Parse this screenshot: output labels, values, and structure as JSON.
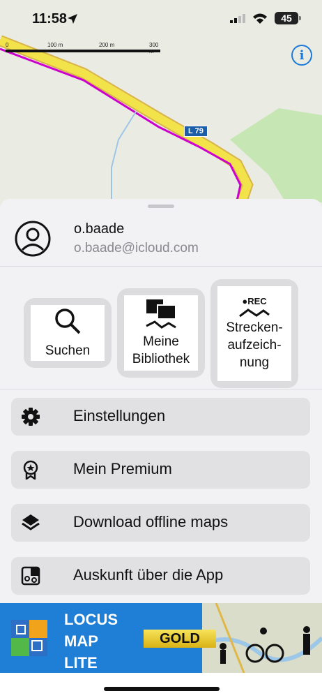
{
  "status_bar": {
    "time": "11:58",
    "battery": "45"
  },
  "map": {
    "scale_labels": [
      "0",
      "100 m",
      "200 m",
      "300 m"
    ],
    "road_label": "L 79",
    "info_icon": "info-icon"
  },
  "profile": {
    "name": "o.baade",
    "email": "o.baade@icloud.com",
    "avatar_icon": "user-circle-icon"
  },
  "tiles": [
    {
      "label_lines": [
        "Suchen"
      ],
      "icon": "search-icon"
    },
    {
      "label_lines": [
        "Meine",
        "Bibliothek"
      ],
      "icon": "library-icon"
    },
    {
      "label_lines": [
        "Strecken-",
        "aufzeich-",
        "nung"
      ],
      "icon": "rec-track-icon",
      "icon_text": "●REC"
    }
  ],
  "menu": [
    {
      "label": "Einstellungen",
      "icon": "gear-icon"
    },
    {
      "label": "Mein Premium",
      "icon": "premium-badge-icon"
    },
    {
      "label": "Download offline maps",
      "icon": "layers-icon"
    },
    {
      "label": "Auskunft über die App",
      "icon": "puzzle-info-icon"
    }
  ],
  "banner": {
    "lines": [
      "LOCUS",
      "MAP",
      "LITE"
    ],
    "badge": "GOLD",
    "accent": "#1f7fd6"
  },
  "colors": {
    "road_fill": "#f3e34b",
    "track": "#cc00cc",
    "info_blue": "#1d7ad8"
  }
}
